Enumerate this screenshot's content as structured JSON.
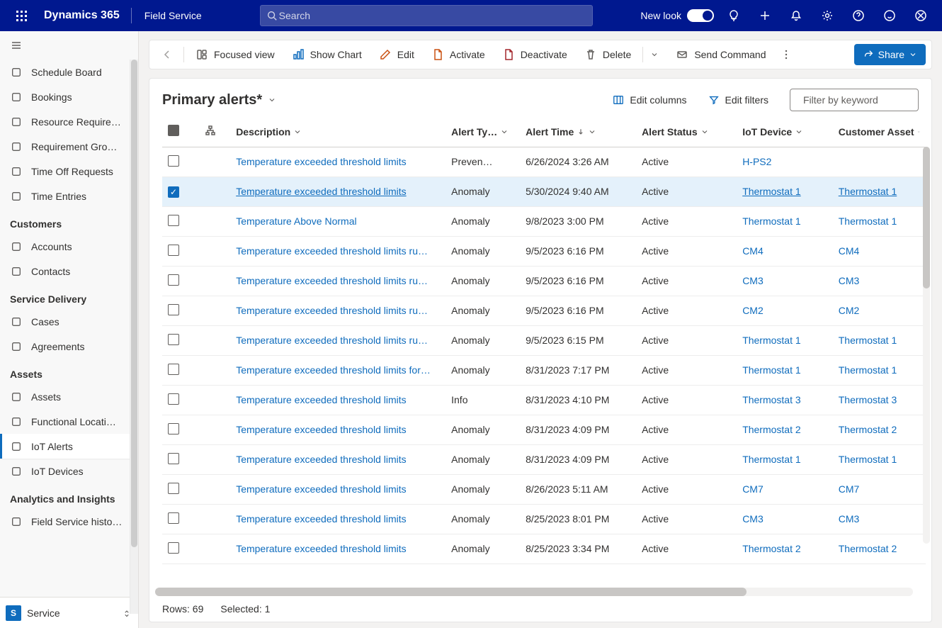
{
  "topbar": {
    "brand": "Dynamics 365",
    "app": "Field Service",
    "search_placeholder": "Search",
    "newlook": "New look"
  },
  "sidebar": {
    "items1": [
      {
        "label": "Schedule Board",
        "icon": "calendar"
      },
      {
        "label": "Bookings",
        "icon": "people"
      },
      {
        "label": "Resource Require…",
        "icon": "people-list"
      },
      {
        "label": "Requirement Gro…",
        "icon": "grid"
      },
      {
        "label": "Time Off Requests",
        "icon": "clock-off"
      },
      {
        "label": "Time Entries",
        "icon": "calendar2"
      }
    ],
    "section_customers": "Customers",
    "items_customers": [
      {
        "label": "Accounts",
        "icon": "building"
      },
      {
        "label": "Contacts",
        "icon": "person"
      }
    ],
    "section_service": "Service Delivery",
    "items_service": [
      {
        "label": "Cases",
        "icon": "wrench"
      },
      {
        "label": "Agreements",
        "icon": "doc"
      }
    ],
    "section_assets": "Assets",
    "items_assets": [
      {
        "label": "Assets",
        "icon": "cube"
      },
      {
        "label": "Functional Locati…",
        "icon": "pin"
      },
      {
        "label": "IoT Alerts",
        "icon": "iot",
        "active": true
      },
      {
        "label": "IoT Devices",
        "icon": "chip"
      }
    ],
    "section_analytics": "Analytics and Insights",
    "items_analytics": [
      {
        "label": "Field Service histo…",
        "icon": "gauge"
      }
    ],
    "area_letter": "S",
    "area_name": "Service"
  },
  "commands": {
    "focused_view": "Focused view",
    "show_chart": "Show Chart",
    "edit": "Edit",
    "activate": "Activate",
    "deactivate": "Deactivate",
    "delete": "Delete",
    "send_command": "Send Command",
    "share": "Share"
  },
  "header": {
    "title": "Primary alerts*",
    "edit_columns": "Edit columns",
    "edit_filters": "Edit filters",
    "filter_placeholder": "Filter by keyword"
  },
  "columns": {
    "description": "Description",
    "alert_type": "Alert Ty…",
    "alert_time": "Alert Time",
    "alert_status": "Alert Status",
    "iot_device": "IoT Device",
    "customer_asset": "Customer Asset"
  },
  "rows": [
    {
      "desc": "Temperature exceeded threshold limits",
      "type": "Preven…",
      "time": "6/26/2024 3:26 AM",
      "status": "Active",
      "device": "H-PS2",
      "asset": ""
    },
    {
      "desc": "Temperature exceeded threshold limits",
      "type": "Anomaly",
      "time": "5/30/2024 9:40 AM",
      "status": "Active",
      "device": "Thermostat 1",
      "asset": "Thermostat 1",
      "selected": true
    },
    {
      "desc": "Temperature Above Normal",
      "type": "Anomaly",
      "time": "9/8/2023 3:00 PM",
      "status": "Active",
      "device": "Thermostat 1",
      "asset": "Thermostat 1"
    },
    {
      "desc": "Temperature exceeded threshold limits ru…",
      "type": "Anomaly",
      "time": "9/5/2023 6:16 PM",
      "status": "Active",
      "device": "CM4",
      "asset": "CM4"
    },
    {
      "desc": "Temperature exceeded threshold limits ru…",
      "type": "Anomaly",
      "time": "9/5/2023 6:16 PM",
      "status": "Active",
      "device": "CM3",
      "asset": "CM3"
    },
    {
      "desc": "Temperature exceeded threshold limits ru…",
      "type": "Anomaly",
      "time": "9/5/2023 6:16 PM",
      "status": "Active",
      "device": "CM2",
      "asset": "CM2"
    },
    {
      "desc": "Temperature exceeded threshold limits ru…",
      "type": "Anomaly",
      "time": "9/5/2023 6:15 PM",
      "status": "Active",
      "device": "Thermostat 1",
      "asset": "Thermostat 1"
    },
    {
      "desc": "Temperature exceeded threshold limits for…",
      "type": "Anomaly",
      "time": "8/31/2023 7:17 PM",
      "status": "Active",
      "device": "Thermostat 1",
      "asset": "Thermostat 1"
    },
    {
      "desc": "Temperature exceeded threshold limits",
      "type": "Info",
      "time": "8/31/2023 4:10 PM",
      "status": "Active",
      "device": "Thermostat 3",
      "asset": "Thermostat 3"
    },
    {
      "desc": "Temperature exceeded threshold limits",
      "type": "Anomaly",
      "time": "8/31/2023 4:09 PM",
      "status": "Active",
      "device": "Thermostat 2",
      "asset": "Thermostat 2"
    },
    {
      "desc": "Temperature exceeded threshold limits",
      "type": "Anomaly",
      "time": "8/31/2023 4:09 PM",
      "status": "Active",
      "device": "Thermostat 1",
      "asset": "Thermostat 1"
    },
    {
      "desc": "Temperature exceeded threshold limits",
      "type": "Anomaly",
      "time": "8/26/2023 5:11 AM",
      "status": "Active",
      "device": "CM7",
      "asset": "CM7"
    },
    {
      "desc": "Temperature exceeded threshold limits",
      "type": "Anomaly",
      "time": "8/25/2023 8:01 PM",
      "status": "Active",
      "device": "CM3",
      "asset": "CM3"
    },
    {
      "desc": "Temperature exceeded threshold limits",
      "type": "Anomaly",
      "time": "8/25/2023 3:34 PM",
      "status": "Active",
      "device": "Thermostat 2",
      "asset": "Thermostat 2"
    }
  ],
  "footer": {
    "rows": "Rows: 69",
    "selected": "Selected: 1"
  }
}
